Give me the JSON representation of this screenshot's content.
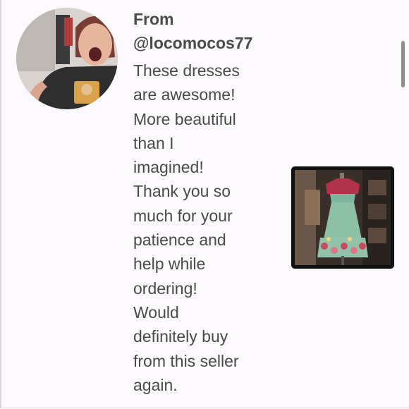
{
  "review": {
    "from_label": "From",
    "username": "@locomocos77",
    "text_lines": [
      "These dresses",
      "are awesome!",
      "More beautiful",
      "than I",
      "imagined!",
      "Thank you so",
      "much for your",
      "patience and",
      "help while",
      "ordering!",
      "Would",
      "definitely buy",
      "from this seller",
      "again."
    ],
    "avatar_icon": "user-avatar-photo",
    "photo_icon": "dress-photo"
  },
  "colors": {
    "background": "#fbf9fb",
    "text": "#4a4a4a",
    "scrollbar": "#8e8e8e"
  }
}
